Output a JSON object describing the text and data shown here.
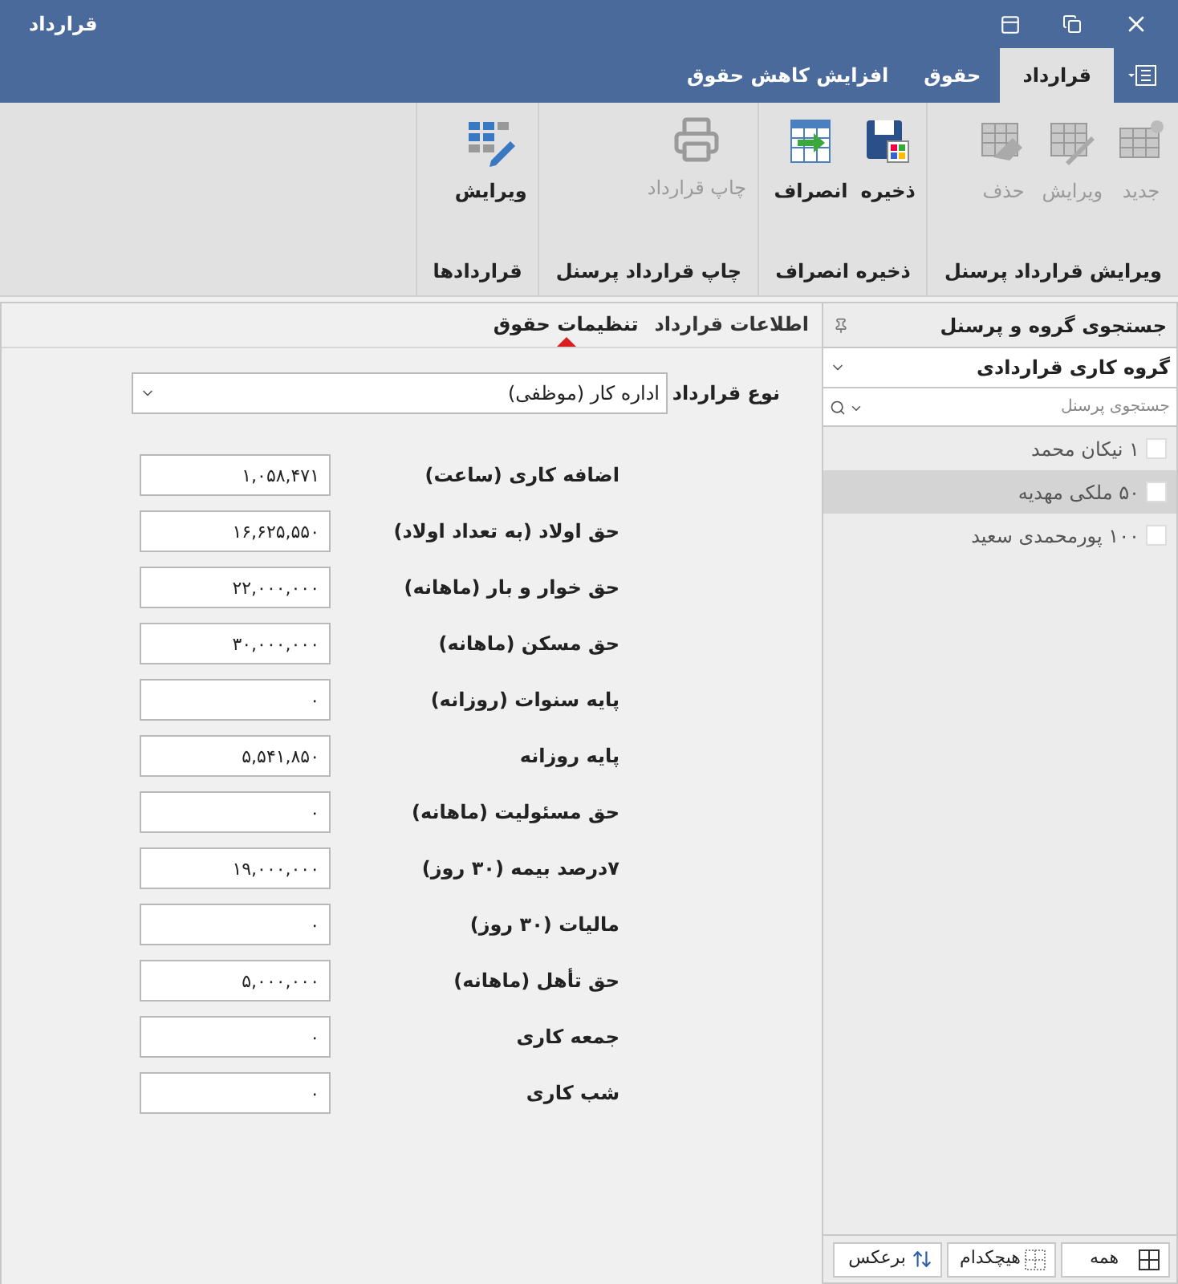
{
  "window": {
    "title": "قرارداد"
  },
  "ribbon_tabs": [
    {
      "label": "قرارداد",
      "selected": true
    },
    {
      "label": "حقوق",
      "selected": false
    },
    {
      "label": "افزایش کاهش حقوق",
      "selected": false
    }
  ],
  "ribbon_groups": [
    {
      "label": "ویرایش قرارداد پرسنل",
      "buttons": [
        {
          "label": "جدید",
          "kind": "new",
          "disabled": true
        },
        {
          "label": "ویرایش",
          "kind": "edit",
          "disabled": true
        },
        {
          "label": "حذف",
          "kind": "delete",
          "disabled": true
        }
      ]
    },
    {
      "label": "ذخیره انصراف",
      "buttons": [
        {
          "label": "ذخیره",
          "kind": "save",
          "disabled": false
        },
        {
          "label": "انصراف",
          "kind": "cancel",
          "disabled": false
        }
      ]
    },
    {
      "label": "چاپ قرارداد پرسنل",
      "buttons": [
        {
          "label": "چاپ قرارداد",
          "kind": "print",
          "disabled": true
        }
      ]
    },
    {
      "label": "قراردادها",
      "buttons": [
        {
          "label": "ویرایش",
          "kind": "gridedit",
          "disabled": false
        }
      ]
    }
  ],
  "content_tabs": [
    {
      "label": "اطلاعات قرارداد",
      "selected": false
    },
    {
      "label": "تنظیمات حقوق",
      "selected": true
    }
  ],
  "contract_type": {
    "label": "نوع قرارداد",
    "value": "اداره کار (موظفی)"
  },
  "fields": [
    {
      "label": "اضافه کاری (ساعت)",
      "value": "۱,۰۵۸,۴۷۱"
    },
    {
      "label": "حق اولاد (به تعداد اولاد)",
      "value": "۱۶,۶۲۵,۵۵۰"
    },
    {
      "label": "حق خوار و بار (ماهانه)",
      "value": "۲۲,۰۰۰,۰۰۰"
    },
    {
      "label": "حق مسکن (ماهانه)",
      "value": "۳۰,۰۰۰,۰۰۰"
    },
    {
      "label": "پایه سنوات (روزانه)",
      "value": "۰"
    },
    {
      "label": "پایه روزانه",
      "value": "۵,۵۴۱,۸۵۰"
    },
    {
      "label": "حق مسئولیت (ماهانه)",
      "value": "۰"
    },
    {
      "label": "۷درصد بیمه (۳۰ روز)",
      "value": "۱۹,۰۰۰,۰۰۰"
    },
    {
      "label": "مالیات (۳۰ روز)",
      "value": "۰"
    },
    {
      "label": "حق تأهل (ماهانه)",
      "value": "۵,۰۰۰,۰۰۰"
    },
    {
      "label": "جمعه کاری",
      "value": "۰"
    },
    {
      "label": "شب کاری",
      "value": "۰"
    }
  ],
  "side_panel": {
    "title": "جستجوی گروه  و پرسنل",
    "group": "گروه کاری قراردادی",
    "search": {
      "placeholder": "جستجوی پرسنل"
    },
    "people": [
      {
        "name": "۱ نیکان محمد",
        "selected": false,
        "checked": false
      },
      {
        "name": "۵۰ ملکی مهدیه",
        "selected": true,
        "checked": false
      },
      {
        "name": "۱۰۰ پورمحمدی سعید",
        "selected": false,
        "checked": false
      }
    ],
    "buttons": [
      {
        "label": "همه",
        "kind": "all"
      },
      {
        "label": "هیچکدام",
        "kind": "none"
      },
      {
        "label": "برعکس",
        "kind": "invert"
      }
    ]
  }
}
